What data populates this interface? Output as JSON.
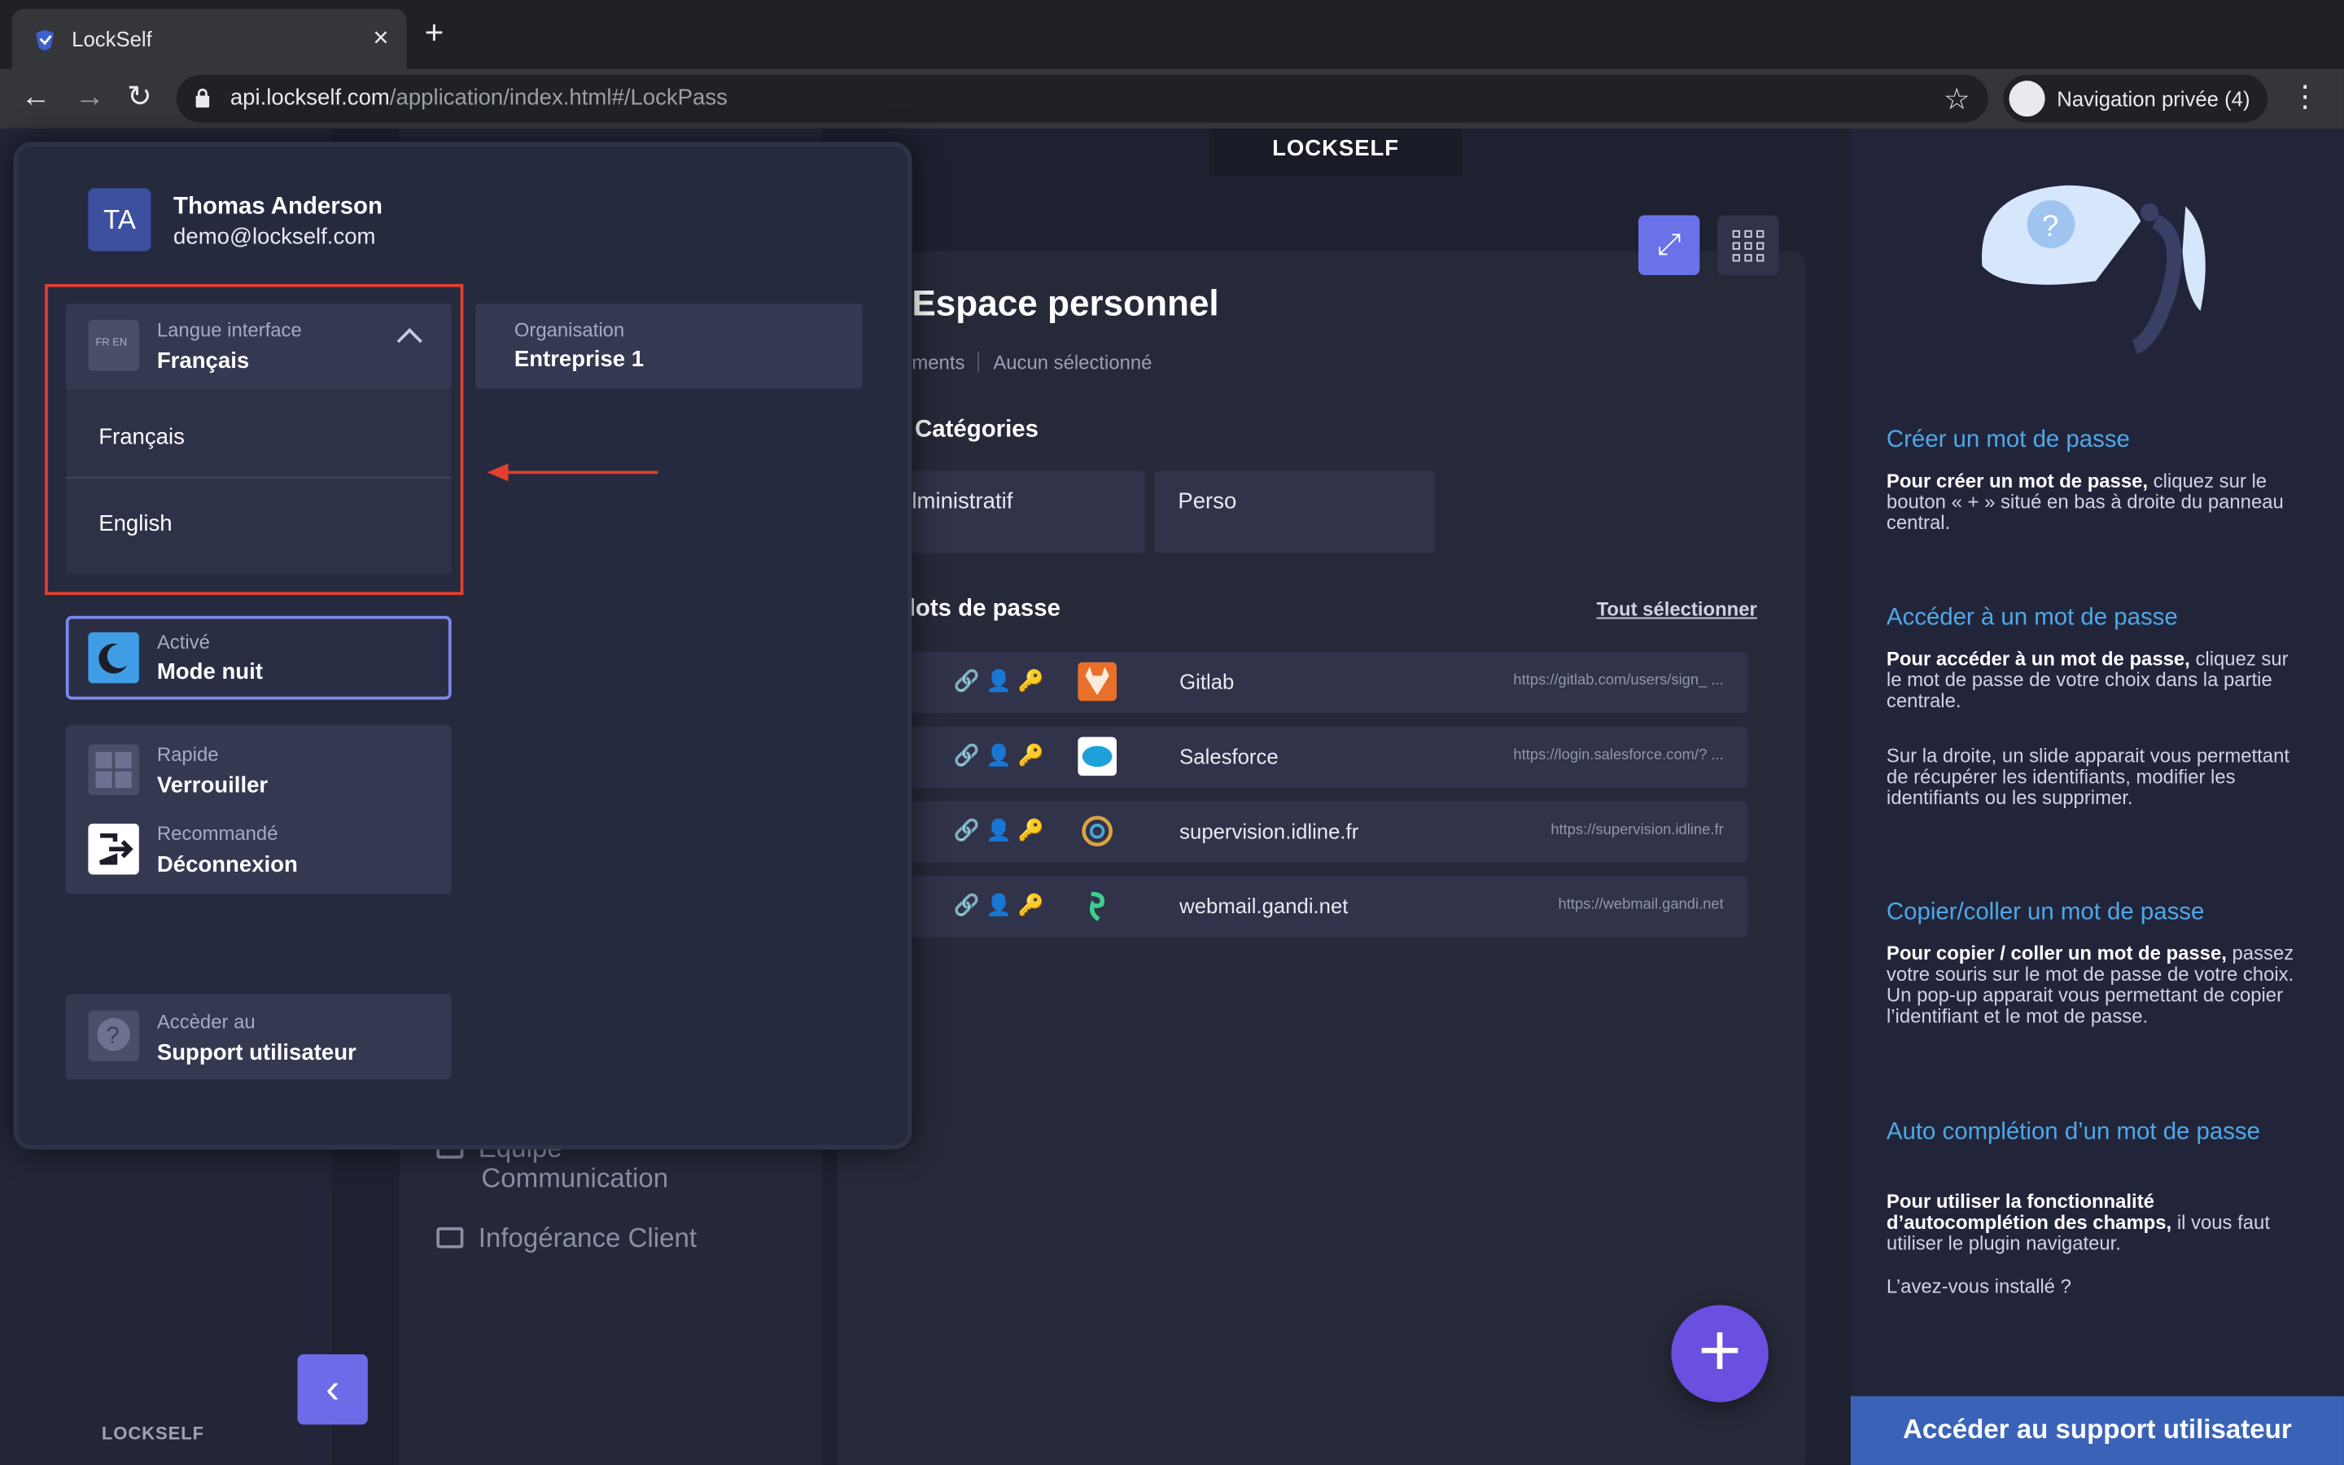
{
  "browser": {
    "tab_title": "LockSelf",
    "url_host": "api.lockself.com",
    "url_path": "/application/index.html#/LockPass",
    "incognito_label": "Navigation privée (4)",
    "new_tab_glyph": "+",
    "close_glyph": "×"
  },
  "app": {
    "logo_text": "LOCKSELF",
    "page_title": "Espace personnel",
    "crumb_left": "ments",
    "crumb_right": "Aucun sélectionné",
    "categories_title": "Catégories",
    "categories": [
      "lministratif",
      "Perso"
    ],
    "passwords_title": "lots de passe",
    "select_all": "Tout sélectionner",
    "passwords": [
      {
        "name": "Gitlab",
        "url": "https://gitlab.com/users/sign_ ...",
        "logo_color": "#e8702a"
      },
      {
        "name": "Salesforce",
        "url": "https://login.salesforce.com/? ...",
        "logo_color": "#1ea0db"
      },
      {
        "name": "supervision.idline.fr",
        "url": "https://supervision.idline.fr",
        "logo_color": "#2b2f44"
      },
      {
        "name": "webmail.gandi.net",
        "url": "https://webmail.gandi.net",
        "logo_color": "#2b2f44"
      }
    ],
    "folders": [
      "Equipe",
      "Communication",
      "Infogérance Client"
    ],
    "bottom_logo": "LOCKSELF"
  },
  "help": {
    "sections": [
      {
        "title": "Créer un mot de passe",
        "bold": "Pour créer un mot de passe,",
        "text": " cliquez sur le bouton « + » situé en bas à droite du panneau central."
      },
      {
        "title": "Accéder à un mot de passe",
        "bold": "Pour accéder à un mot de passe,",
        "text": " cliquez sur le mot de passe de votre choix dans la partie centrale."
      },
      {
        "title": "",
        "bold": "",
        "text": "Sur la droite, un slide apparait vous permettant de récupérer les identifiants, modifier les identifiants ou les supprimer."
      },
      {
        "title": "Copier/coller un mot de passe",
        "bold": "Pour copier / coller un mot de passe,",
        "text": " passez votre souris sur le mot de passe de votre choix. Un pop-up apparait vous permettant de copier l’identifiant et le mot de passe."
      },
      {
        "title": "Auto complétion d’un mot de passe",
        "bold": "Pour utiliser la fonctionnalité d’autocomplétion des champs,",
        "text": " il vous faut utiliser le plugin navigateur."
      },
      {
        "title": "",
        "bold": "",
        "text": "L’avez-vous installé ?"
      }
    ],
    "support_button": "Accéder au support utilisateur"
  },
  "user_panel": {
    "initials": "TA",
    "name": "Thomas Anderson",
    "email": "demo@lockself.com",
    "language": {
      "label": "Langue interface",
      "value": "Français",
      "options": [
        "Français",
        "English"
      ],
      "flag_text": "FR EN"
    },
    "organisation": {
      "label": "Organisation",
      "value": "Entreprise 1"
    },
    "night_mode": {
      "label": "Activé",
      "value": "Mode nuit"
    },
    "lock": {
      "label": "Rapide",
      "value": "Verrouiller"
    },
    "logout": {
      "label": "Recommandé",
      "value": "Déconnexion"
    },
    "support": {
      "label": "Accèder au",
      "value": "Support utilisateur"
    }
  },
  "colors": {
    "accent": "#6b72e8",
    "highlight": "#e2402f",
    "help_link": "#4fa8e8",
    "fab": "#6a4fe0"
  }
}
